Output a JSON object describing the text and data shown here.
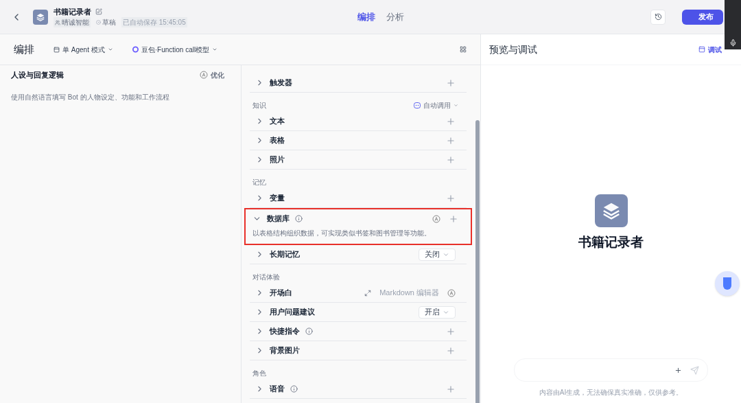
{
  "header": {
    "bot_name": "书籍记录者",
    "owner": "晴诚智能",
    "status": "草稿",
    "saved": "已自动保存 15:45:05",
    "tabs": [
      {
        "label": "编排",
        "selected": true
      },
      {
        "label": "分析",
        "selected": false
      }
    ],
    "publish": "发布"
  },
  "toolbar": {
    "title": "编排",
    "mode": "单 Agent 模式",
    "model": "豆包·Function call模型"
  },
  "persona": {
    "title": "人设与回复逻辑",
    "optimize": "优化",
    "placeholder": "使用自然语言填写 Bot 的人物设定、功能和工作流程"
  },
  "sections": [
    {
      "items": [
        {
          "label": "触发器",
          "kind": "plus",
          "expanded": false,
          "info": false,
          "highlighted": false
        }
      ]
    },
    {
      "title": "知识",
      "action": "自动调用",
      "items": [
        {
          "label": "文本",
          "kind": "plus",
          "expanded": false,
          "info": false,
          "highlighted": false
        },
        {
          "label": "表格",
          "kind": "plus",
          "expanded": false,
          "info": false,
          "highlighted": false
        },
        {
          "label": "照片",
          "kind": "plus",
          "expanded": false,
          "info": false,
          "highlighted": false
        }
      ]
    },
    {
      "title": "记忆",
      "items": [
        {
          "label": "变量",
          "kind": "plus",
          "expanded": false,
          "info": false,
          "highlighted": false
        },
        {
          "label": "数据库",
          "kind": "plus_auto",
          "expanded": true,
          "info": true,
          "highlighted": true,
          "description": "以表格结构组织数据，可实现类似书签和图书管理等功能。"
        },
        {
          "label": "长期记忆",
          "kind": "select",
          "value": "关闭",
          "expanded": false,
          "info": false,
          "highlighted": false
        }
      ]
    },
    {
      "title": "对话体验",
      "items": [
        {
          "label": "开场白",
          "kind": "markdown",
          "value": "Markdown 编辑器",
          "expanded": false,
          "info": false,
          "highlighted": false
        },
        {
          "label": "用户问题建议",
          "kind": "select",
          "value": "开启",
          "expanded": false,
          "info": false,
          "highlighted": false
        },
        {
          "label": "快捷指令",
          "kind": "plus",
          "expanded": false,
          "info": true,
          "highlighted": false
        },
        {
          "label": "背景图片",
          "kind": "plus",
          "expanded": false,
          "info": false,
          "highlighted": false
        }
      ]
    },
    {
      "title": "角色",
      "items": [
        {
          "label": "语音",
          "kind": "plus",
          "expanded": false,
          "info": true,
          "highlighted": false
        }
      ]
    }
  ],
  "preview": {
    "title": "预览与调试",
    "debug": "调试",
    "bot_name": "书籍记录者",
    "disclaimer": "内容由AI生成，无法确保真实准确，仅供参考。"
  }
}
